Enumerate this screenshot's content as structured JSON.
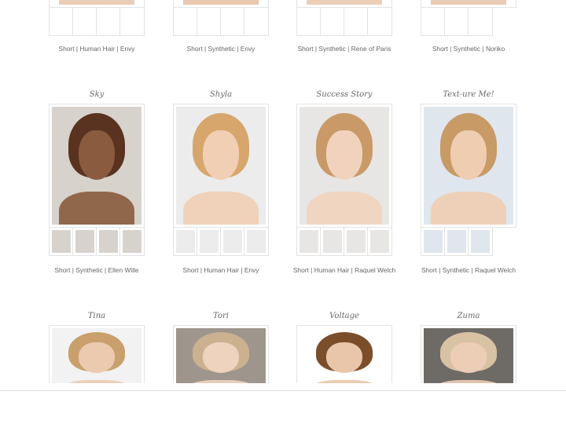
{
  "rows": [
    {
      "products": [
        {
          "title": "",
          "meta": "Short | Human Hair | Envy",
          "thumb_count": 4,
          "hair": "#6b4a33",
          "skin": "#e9c9b0",
          "bg": "#ffffff"
        },
        {
          "title": "",
          "meta": "Short | Synthetic | Envy",
          "thumb_count": 4,
          "hair": "#8a6340",
          "skin": "#e7c3a6",
          "bg": "#ffffff"
        },
        {
          "title": "",
          "meta": "Short | Synthetic | Rene of Paris",
          "thumb_count": 4,
          "hair": "#7a5a3e",
          "skin": "#ebcab0",
          "bg": "#ffffff"
        },
        {
          "title": "",
          "meta": "Short | Synthetic | Noriko",
          "thumb_count": 3,
          "hair": "#3f342c",
          "skin": "#e7c7ad",
          "bg": "#ffffff"
        }
      ]
    },
    {
      "products": [
        {
          "title": "Sky",
          "meta": "Short | Synthetic | Ellen Wille",
          "thumb_count": 4,
          "hair": "#5a3220",
          "skin": "#8a5b3e",
          "bg": "#d8d2cc"
        },
        {
          "title": "Shyla",
          "meta": "Short | Human Hair | Envy",
          "thumb_count": 4,
          "hair": "#d6a66c",
          "skin": "#f0cfb4",
          "bg": "#ececec"
        },
        {
          "title": "Success Story",
          "meta": "Short | Human Hair | Raquel Welch",
          "thumb_count": 4,
          "hair": "#c99a67",
          "skin": "#f1d3bd",
          "bg": "#e8e6e4"
        },
        {
          "title": "Text-ure Me!",
          "meta": "Short | Synthetic | Raquel Welch",
          "thumb_count": 3,
          "hair": "#c89a66",
          "skin": "#efcdb1",
          "bg": "#dfe6ee"
        }
      ]
    },
    {
      "products": [
        {
          "title": "Tina",
          "meta": "",
          "thumb_count": 0,
          "hair": "#c9a06c",
          "skin": "#eccab0",
          "bg": "#f2f2f2"
        },
        {
          "title": "Tori",
          "meta": "",
          "thumb_count": 0,
          "hair": "#cbb190",
          "skin": "#eed3bf",
          "bg": "#9e958c"
        },
        {
          "title": "Voltage",
          "meta": "",
          "thumb_count": 0,
          "hair": "#7b4e2b",
          "skin": "#e9c6aa",
          "bg": "#ffffff"
        },
        {
          "title": "Zuma",
          "meta": "",
          "thumb_count": 0,
          "hair": "#d8c2a4",
          "skin": "#eccdb6",
          "bg": "#6e6a66"
        }
      ]
    }
  ]
}
